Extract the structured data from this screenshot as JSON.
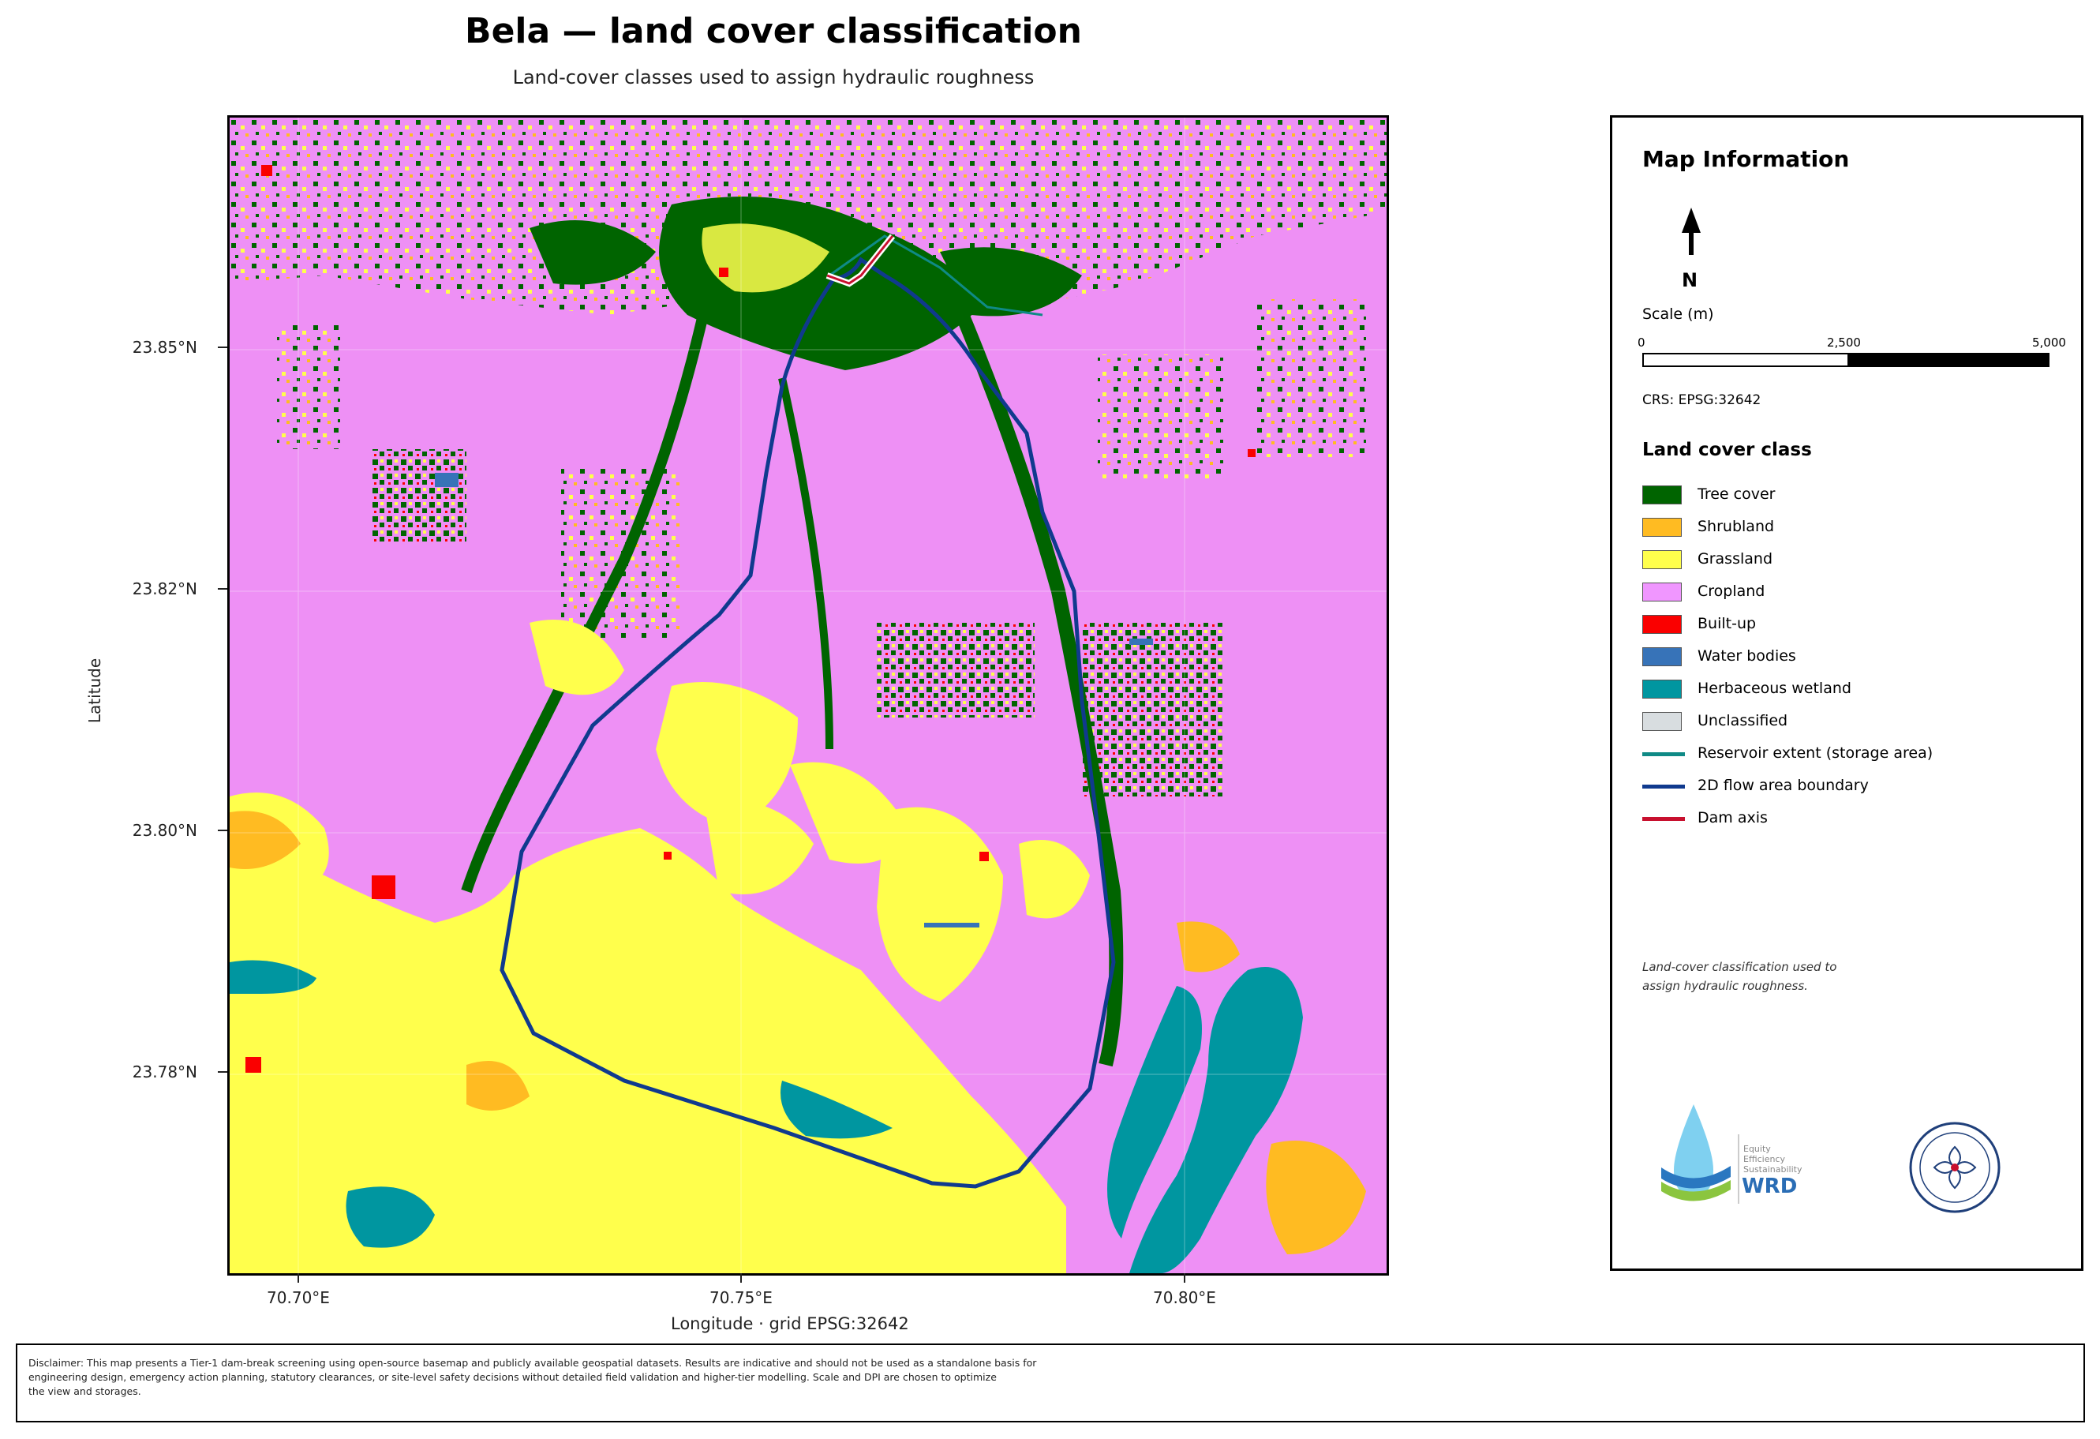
{
  "title": "Bela — land cover classification",
  "subtitle": "Land-cover classes used to assign hydraulic roughness",
  "axes": {
    "y_label": "Latitude",
    "x_label": "Longitude   ·   grid EPSG:32642",
    "y_ticks": [
      "23.85°N",
      "23.82°N",
      "23.80°N",
      "23.78°N"
    ],
    "x_ticks": [
      "70.70°E",
      "70.75°E",
      "70.80°E"
    ]
  },
  "info_panel": {
    "title": "Map Information",
    "north_label": "N",
    "scale_title": "Scale (m)",
    "scale_ticks": [
      "0",
      "2,500",
      "5,000"
    ],
    "crs": "CRS: EPSG:32642",
    "legend_title": "Land cover class",
    "legend": [
      {
        "label": "Tree cover",
        "color": "#006400",
        "kind": "patch"
      },
      {
        "label": "Shrubland",
        "color": "#ffbb22",
        "kind": "patch"
      },
      {
        "label": "Grassland",
        "color": "#ffff4c",
        "kind": "patch"
      },
      {
        "label": "Cropland",
        "color": "#f096ff",
        "kind": "patch"
      },
      {
        "label": "Built-up",
        "color": "#fa0000",
        "kind": "patch"
      },
      {
        "label": "Water bodies",
        "color": "#3773b8",
        "kind": "patch"
      },
      {
        "label": "Herbaceous wetland",
        "color": "#0096a0",
        "kind": "patch"
      },
      {
        "label": "Unclassified",
        "color": "#d8dde0",
        "kind": "patch"
      },
      {
        "label": "Reservoir extent (storage area)",
        "color": "#0f8a86",
        "kind": "line"
      },
      {
        "label": "2D flow area boundary",
        "color": "#103a8e",
        "kind": "line"
      },
      {
        "label": "Dam axis",
        "color": "#c8102e",
        "kind": "line"
      }
    ],
    "note_line1": "Land-cover classification used to",
    "note_line2": "assign hydraulic roughness.",
    "logo_text": [
      "Equity",
      "Efficiency",
      "Sustainability",
      "WRD"
    ]
  },
  "disclaimer": {
    "line1": "Disclaimer: This map presents a Tier-1 dam-break screening using open-source basemap and publicly available geospatial datasets. Results are indicative and should not be used as a standalone basis for",
    "line2": "engineering design, emergency action planning, statutory clearances, or site-level safety decisions without detailed field validation and higher-tier modelling. Scale and DPI are chosen to optimize",
    "line3": "the view and storages."
  }
}
